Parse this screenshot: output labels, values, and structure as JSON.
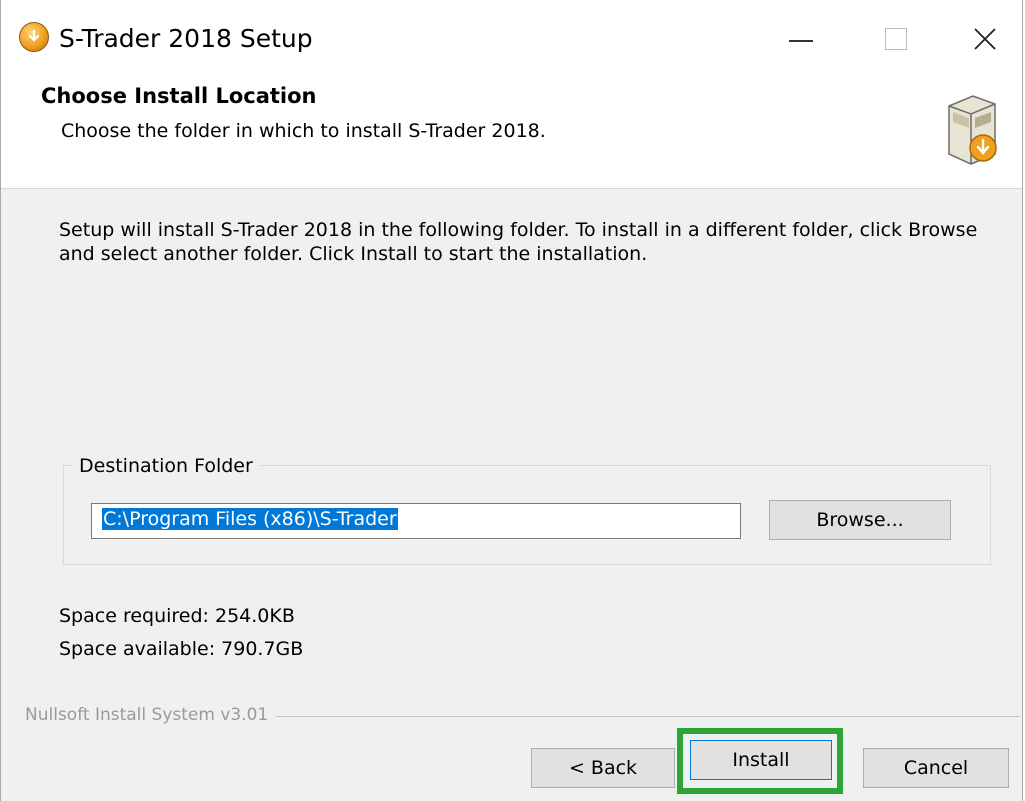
{
  "window": {
    "title": "S-Trader 2018 Setup",
    "icon": "installer-disc-icon"
  },
  "header": {
    "title": "Choose Install Location",
    "subtitle": "Choose the folder in which to install S-Trader 2018.",
    "icon": "install-box-icon"
  },
  "body": {
    "intro": "Setup will install S-Trader 2018 in the following folder. To install in a different folder, click Browse and select another folder. Click Install to start the installation.",
    "destination": {
      "legend": "Destination Folder",
      "path": "C:\\Program Files (x86)\\S-Trader",
      "browse_label": "Browse..."
    },
    "space_required": "Space required: 254.0KB",
    "space_available": "Space available: 790.7GB"
  },
  "footer": {
    "brand": "Nullsoft Install System v3.01",
    "back_label": "< Back",
    "install_label": "Install",
    "cancel_label": "Cancel"
  },
  "colors": {
    "highlight": "#2fa436",
    "selection": "#0078d7"
  }
}
